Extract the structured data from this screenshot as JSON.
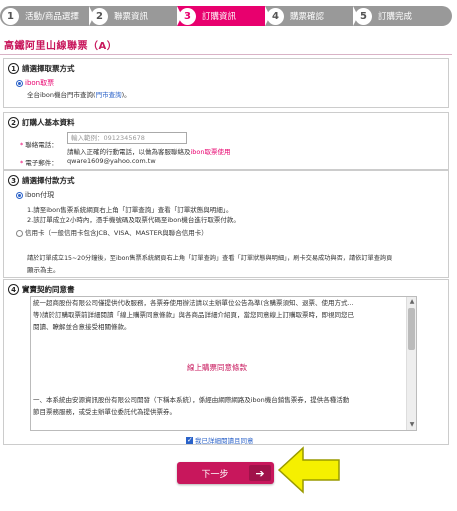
{
  "steps": [
    {
      "num": "1",
      "label": "活動/商品選擇",
      "active": false
    },
    {
      "num": "2",
      "label": "聯票資訊",
      "active": false
    },
    {
      "num": "3",
      "label": "訂購資訊",
      "active": true
    },
    {
      "num": "4",
      "label": "購票確認",
      "active": false
    },
    {
      "num": "5",
      "label": "訂購完成",
      "active": false
    }
  ],
  "page_title": "高鐵阿里山線聯票（A）",
  "section1": {
    "num": "1",
    "title": "請選擇取票方式",
    "option": "ibon取票",
    "desc_prefix": "全台ibon機台門市查詢(",
    "desc_link": "門市查詢",
    "desc_suffix": ")。"
  },
  "section2": {
    "num": "2",
    "title": "訂購人基本資料",
    "phone_label": "聯絡電話：",
    "phone_placeholder": "輸入範例：0912345678",
    "phone_hint_prefix": "請輸入正確的行動電話，以做為客服聯絡及",
    "phone_hint_link": "ibon取票使用",
    "email_label": "電子郵件：",
    "email_value": "qware1609@yahoo.com.tw"
  },
  "section3": {
    "num": "3",
    "title": "請選擇付款方式",
    "option1": "ibon付現",
    "option1_line1": "1.請至ibon售票系統網頁右上角「訂單查詢」查看「訂單狀態與明細」。",
    "option1_line2": "2.該訂單成立2小時內，憑手機號碼及取票代碼至ibon機台進行取票付款。",
    "option2": "信用卡（一般信用卡包含JCB、VISA、MASTER與聯合信用卡）",
    "option2_line1": "請於訂單成立15~20分鐘後，至ibon售票系統網頁右上角「訂單查詢」查看「訂單狀態與明細」，刷卡交易成功與否，請依訂單查詢頁",
    "option2_line2": "顯示為主。"
  },
  "section4": {
    "num": "4",
    "title": "實賣契約同意書",
    "text_line1": "統一超商股份有限公司僅提供代收服務，各票券使用辦法請以主辦單位公告為準(含購票須知、退票、使用方式...",
    "text_line2": "等)請於訂購取票前詳細閱讀「線上購票同意條款」與各商品詳細介紹頁，當您同意線上訂購取票時，即視同您已",
    "text_line3": "閱讀、瞭解並合意接受相關條款。",
    "center_title": "線上購票同意條款",
    "text_line4": "一、本系統由安源資訊股份有限公司開發（下稱本系統），係經由網際網路及ibon機台銷售票券，提供各種活動",
    "text_line5": "節目票務服務，或受主辦單位委託代為提供票券。",
    "agree_label": "我已詳細閱讀且同意"
  },
  "next_button": {
    "label": "下一步",
    "arrow": "➔"
  },
  "colors": {
    "accent": "#e8006e",
    "title": "#c8175c",
    "step_inactive": "#999999",
    "link": "#2a62c9"
  }
}
